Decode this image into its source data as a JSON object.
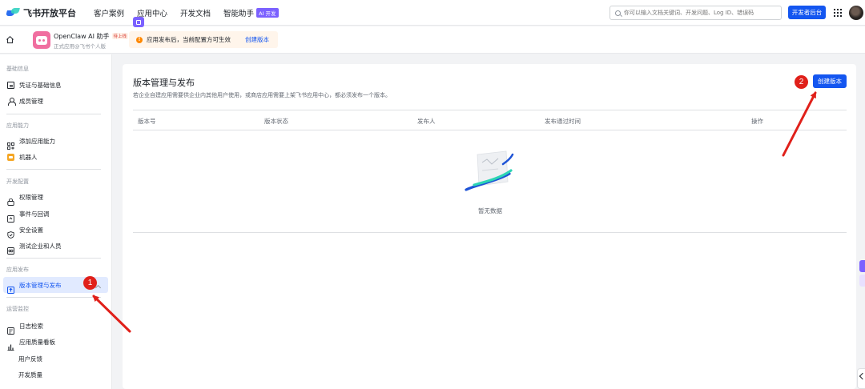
{
  "topnav": {
    "brand": "飞书开放平台",
    "items": [
      "客户案例",
      "应用中心",
      "开发文档",
      "智能助手"
    ],
    "ai_badge": "AI 开发",
    "search_placeholder": "你可以输入文档关键词、开发问题、Log ID、错误码",
    "dev_console": "开发者后台"
  },
  "appbar": {
    "app_name": "OpenClaw AI 助手",
    "status_badge": "待上线",
    "app_sub": "正式应用@飞书个人版",
    "notice": "应用发布后，当前配置方可生效",
    "notice_link": "创建版本"
  },
  "sidebar": {
    "sections": [
      {
        "title": "基础信息",
        "items": [
          "凭证与基础信息",
          "成员管理"
        ]
      },
      {
        "title": "应用能力",
        "items": [
          "添加应用能力",
          "机器人"
        ]
      },
      {
        "title": "开发配置",
        "items": [
          "权限管理",
          "事件与回调",
          "安全设置",
          "测试企业和人员"
        ]
      },
      {
        "title": "应用发布",
        "items": [
          "版本管理与发布"
        ]
      },
      {
        "title": "运营监控",
        "items": [
          "日志检索",
          "应用质量看板",
          "用户反馈",
          "开发质量"
        ]
      }
    ]
  },
  "main": {
    "title": "版本管理与发布",
    "description": "若企业自建应用需要供企业内其他用户使用，或商店应用需要上架飞书应用中心，都必须发布一个版本。",
    "create_button": "创建版本",
    "columns": [
      "版本号",
      "版本状态",
      "发布人",
      "发布通过时间",
      "操作"
    ],
    "empty_text": "暂无数据"
  },
  "annotations": {
    "mark1": "1",
    "mark2": "2",
    "color": "#e0201a"
  },
  "colors": {
    "primary": "#1456f0",
    "ai": "#7b61ff",
    "warning": "#ff8800"
  }
}
